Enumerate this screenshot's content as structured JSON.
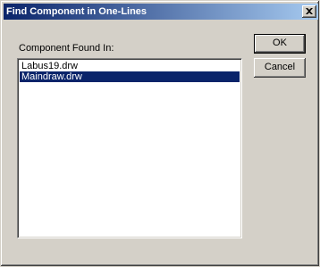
{
  "window": {
    "title": "Find Component in One-Lines"
  },
  "dialog": {
    "found_in_label": "Component Found In:",
    "list_items": [
      {
        "label": "Labus19.drw",
        "selected": false
      },
      {
        "label": "Maindraw.drw",
        "selected": true
      }
    ],
    "ok_label": "OK",
    "cancel_label": "Cancel"
  },
  "colors": {
    "titlebar_start": "#0a246a",
    "titlebar_end": "#a6caf0",
    "selection": "#0a246a",
    "face": "#d4d0c8"
  },
  "icons": {
    "close": "close-icon"
  }
}
